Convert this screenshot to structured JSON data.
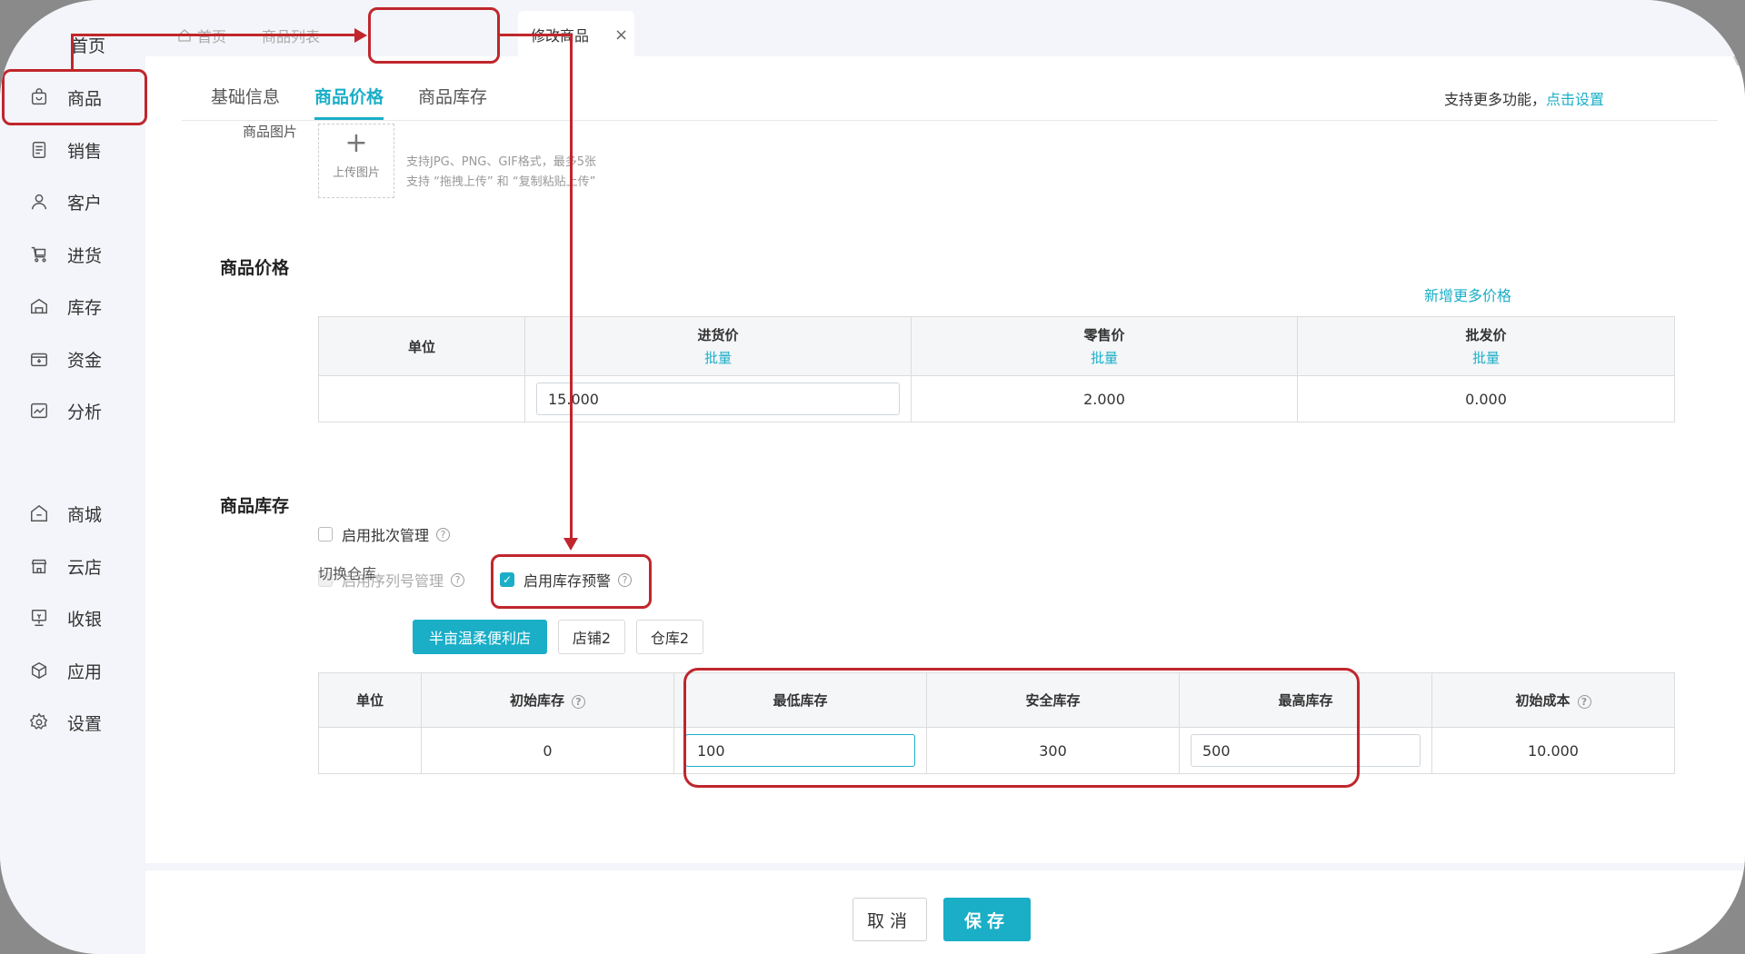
{
  "sidebar": {
    "home_label": "首页",
    "items": [
      {
        "label": "商品",
        "icon": "bag-icon"
      },
      {
        "label": "销售",
        "icon": "receipt-icon"
      },
      {
        "label": "客户",
        "icon": "user-icon"
      },
      {
        "label": "进货",
        "icon": "cart-icon"
      },
      {
        "label": "库存",
        "icon": "warehouse-icon"
      },
      {
        "label": "资金",
        "icon": "wallet-icon"
      },
      {
        "label": "分析",
        "icon": "chart-icon"
      },
      {
        "label": "商城",
        "icon": "store-icon"
      },
      {
        "label": "云店",
        "icon": "cloud-store-icon"
      },
      {
        "label": "收银",
        "icon": "cashier-icon"
      },
      {
        "label": "应用",
        "icon": "cube-icon"
      },
      {
        "label": "设置",
        "icon": "gear-icon"
      }
    ]
  },
  "breadcrumb": {
    "home": "首页",
    "list": "商品列表",
    "active_tab": "修改商品",
    "close": "×"
  },
  "subtabs": {
    "basic": "基础信息",
    "price": "商品价格",
    "stock": "商品库存"
  },
  "support": {
    "text": "支持更多功能，",
    "link": "点击设置"
  },
  "image_section": {
    "label": "商品图片",
    "plus": "+",
    "upload_label": "上传图片",
    "hint1": "支持JPG、PNG、GIF格式，最多5张",
    "hint2": "支持 “拖拽上传” 和 “复制粘贴上传”"
  },
  "price_section": {
    "title": "商品价格",
    "add_more": "新增更多价格",
    "headers": {
      "unit": "单位",
      "purchase": "进货价",
      "retail": "零售价",
      "wholesale": "批发价",
      "batch": "批量"
    },
    "row": {
      "unit": "",
      "purchase": "15.000",
      "retail": "2.000",
      "wholesale": "0.000"
    }
  },
  "stock_section": {
    "title": "商品库存",
    "enable_batch": "启用批次管理",
    "enable_serial": "启用序列号管理",
    "enable_alert": "启用库存预警",
    "check_mark": "✓",
    "help": "?",
    "switch_warehouse": "切换仓库",
    "warehouses": [
      "半亩温柔便利店",
      "店铺2",
      "仓库2"
    ],
    "headers": {
      "unit": "单位",
      "initial_stock": "初始库存",
      "min_stock": "最低库存",
      "safe_stock": "安全库存",
      "max_stock": "最高库存",
      "initial_cost": "初始成本"
    },
    "row": {
      "unit": "",
      "initial_stock": "0",
      "min_stock": "100",
      "safe_stock": "300",
      "max_stock": "500",
      "initial_cost": "10.000"
    }
  },
  "footer": {
    "cancel": "取消",
    "save": "保存"
  },
  "colors": {
    "accent": "#1aaec7",
    "annotation": "#c0262c",
    "sidebar_bg": "#f3f5fa"
  }
}
